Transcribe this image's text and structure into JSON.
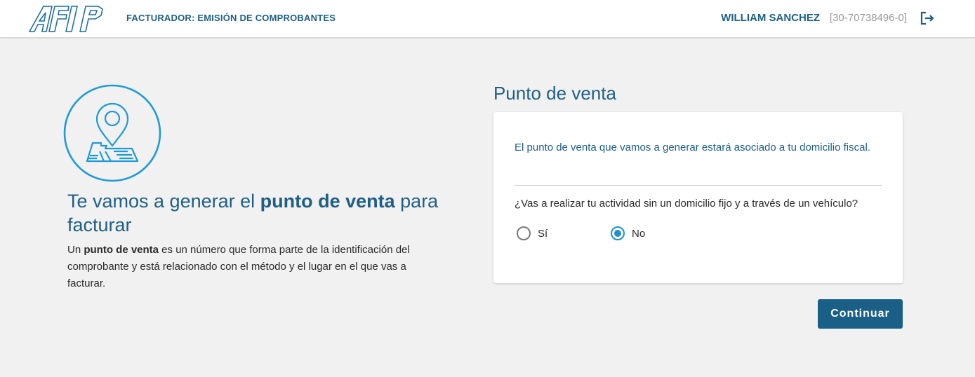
{
  "header": {
    "logo_text": "AFIP",
    "app_title": "FACTURADOR: EMISIÓN DE COMPROBANTES",
    "user_name": "WILLIAM SANCHEZ",
    "user_cuit": "[30-70738496-0]",
    "logout_icon": "logout-icon"
  },
  "intro": {
    "icon": "map-pin-icon",
    "title_part1": "Te vamos a generar el ",
    "title_bold": "punto de venta",
    "title_part2": " para facturar",
    "desc_part1": "Un ",
    "desc_bold": "punto de venta",
    "desc_part2": " es un número que forma parte de la identificación del comprobante y está relacionado con el método y el lugar en el que vas a facturar."
  },
  "panel": {
    "title": "Punto de venta",
    "info": "El punto de venta que vamos a generar estará asociado a tu domicilio fiscal.",
    "question": "¿Vas a realizar tu actividad sin un domicilio fijo y a través de un vehículo?",
    "options": [
      {
        "label": "Sí",
        "selected": false
      },
      {
        "label": "No",
        "selected": true
      }
    ]
  },
  "actions": {
    "continue_label": "Continuar"
  },
  "colors": {
    "primary": "#1f5f86",
    "accent": "#1e8fd0",
    "button": "#1a5f85",
    "background": "#f1f1f1"
  }
}
